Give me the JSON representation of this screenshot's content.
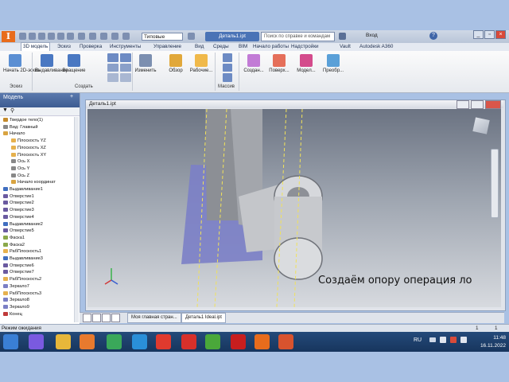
{
  "app": {
    "logo_letter": "I",
    "workspace_combo": "Типовые",
    "document_title": "Деталь1.ipt",
    "search_placeholder": "Поиск по справке и командам",
    "user": "Вход",
    "help": "?"
  },
  "menu": [
    "3D модель",
    "Эскиз",
    "Проверка",
    "Инструменты",
    "Управление",
    "Вид",
    "Среды",
    "BIM",
    "Начало работы",
    "Надстройки",
    "Vault",
    "Autodesk A360"
  ],
  "ribbon": {
    "buttons": [
      {
        "label": "Начать 2D-эскиз",
        "icon": "sketch-icon",
        "color": "#5b8fd3"
      },
      {
        "label": "Выдавливание",
        "icon": "extrude-icon",
        "color": "#4a78c2"
      },
      {
        "label": "Вращение",
        "icon": "revolve-icon",
        "color": "#4a78c2"
      },
      {
        "label": "Изменить",
        "icon": "modify-icon",
        "color": "#7c8fb0"
      },
      {
        "label": "Обзор",
        "icon": "explore-icon",
        "color": "#e1a83a"
      },
      {
        "label": "Рабочие...",
        "icon": "work-features-icon",
        "color": "#f0b94a"
      },
      {
        "label": "Создан...",
        "icon": "create-icon",
        "color": "#c27bd6"
      },
      {
        "label": "Поверх...",
        "icon": "surface-icon",
        "color": "#e56f5a"
      },
      {
        "label": "Модел...",
        "icon": "model-icon",
        "color": "#d44b8c"
      },
      {
        "label": "Преобр...",
        "icon": "convert-icon",
        "color": "#5aa0d8"
      }
    ],
    "panels": [
      "Эскиз",
      "Создать",
      "Массив"
    ]
  },
  "browser": {
    "title": "Модель",
    "items": [
      {
        "label": "Твердое тело(1)",
        "color": "#c48a2c"
      },
      {
        "label": "Вид: Главный",
        "color": "#888"
      },
      {
        "label": "Начало",
        "color": "#d9a441"
      },
      {
        "label": "Плоскость YZ",
        "color": "#e6b14e"
      },
      {
        "label": "Плоскость XZ",
        "color": "#e6b14e"
      },
      {
        "label": "Плоскость XY",
        "color": "#e6b14e"
      },
      {
        "label": "Ось X",
        "color": "#888"
      },
      {
        "label": "Ось Y",
        "color": "#888"
      },
      {
        "label": "Ось Z",
        "color": "#888"
      },
      {
        "label": "Начало координат",
        "color": "#d9a441"
      },
      {
        "label": "Выдавливание1",
        "color": "#3f6ec0"
      },
      {
        "label": "Отверстие1",
        "color": "#6a5aa0"
      },
      {
        "label": "Отверстие2",
        "color": "#6a5aa0"
      },
      {
        "label": "Отверстие3",
        "color": "#6a5aa0"
      },
      {
        "label": "Отверстие4",
        "color": "#6a5aa0"
      },
      {
        "label": "Выдавливание2",
        "color": "#3f6ec0"
      },
      {
        "label": "Отверстие5",
        "color": "#6a5aa0"
      },
      {
        "label": "Фаска1",
        "color": "#8aa84a"
      },
      {
        "label": "Фаска2",
        "color": "#8aa84a"
      },
      {
        "label": "РабПлоскость1",
        "color": "#e6b14e"
      },
      {
        "label": "Выдавливание3",
        "color": "#3f6ec0"
      },
      {
        "label": "Отверстие6",
        "color": "#6a5aa0"
      },
      {
        "label": "Отверстие7",
        "color": "#6a5aa0"
      },
      {
        "label": "РабПлоскость2",
        "color": "#e6b14e"
      },
      {
        "label": "Зеркало7",
        "color": "#7b7fc5"
      },
      {
        "label": "РабПлоскость3",
        "color": "#e6b14e"
      },
      {
        "label": "Зеркало8",
        "color": "#7b7fc5"
      },
      {
        "label": "Зеркало9",
        "color": "#7b7fc5"
      },
      {
        "label": "Конец",
        "color": "#c03a3a"
      }
    ]
  },
  "graphics": {
    "window_title": "Деталь1.ipt",
    "caption": "Создаём опору операция ло"
  },
  "doc_tabs": [
    "Моя главная стран...",
    "Деталь1 Ideal.ipt"
  ],
  "status": {
    "text": "Режим ожидания",
    "right_1": "1",
    "right_2": "1"
  },
  "taskbar": {
    "lang": "RU",
    "time": "11:48",
    "date": "16.11.2022",
    "apps": [
      {
        "name": "windows-start",
        "color": "#3a7fd5"
      },
      {
        "name": "alice",
        "color": "#7a5ae0"
      },
      {
        "name": "file-explorer",
        "color": "#e7b73a"
      },
      {
        "name": "media-player",
        "color": "#e87a2e"
      },
      {
        "name": "chrome",
        "color": "#3aa85a"
      },
      {
        "name": "edge",
        "color": "#2a8fd8"
      },
      {
        "name": "yandex",
        "color": "#e03a2e"
      },
      {
        "name": "opera",
        "color": "#d8302a"
      },
      {
        "name": "utorrent",
        "color": "#4aa83a"
      },
      {
        "name": "acrobat",
        "color": "#c81e1e"
      },
      {
        "name": "inventor",
        "color": "#e86c1c"
      },
      {
        "name": "presentation",
        "color": "#d8532e"
      }
    ]
  }
}
